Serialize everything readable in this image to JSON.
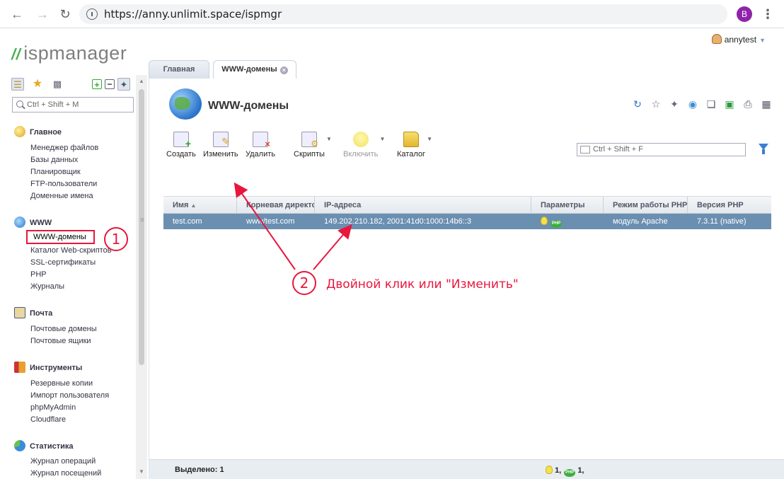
{
  "browser": {
    "url": "https://anny.unlimit.space/ispmgr",
    "profile_initial": "B"
  },
  "app": {
    "logo_text": "ispmanager",
    "user_name": "annytest"
  },
  "tabs": [
    {
      "label": "Главная"
    },
    {
      "label": "WWW-домены"
    }
  ],
  "sidebar": {
    "search_placeholder": "Ctrl + Shift + M",
    "sections": [
      {
        "title": "Главное",
        "items": [
          "Менеджер файлов",
          "Базы данных",
          "Планировщик",
          "FTP-пользователи",
          "Доменные имена"
        ]
      },
      {
        "title": "WWW",
        "items": [
          "WWW-домены",
          "Каталог Web-скриптов",
          "SSL-сертификаты",
          "PHP",
          "Журналы"
        ]
      },
      {
        "title": "Почта",
        "items": [
          "Почтовые домены",
          "Почтовые ящики"
        ]
      },
      {
        "title": "Инструменты",
        "items": [
          "Резервные копии",
          "Импорт пользователя",
          "phpMyAdmin",
          "Cloudflare"
        ]
      },
      {
        "title": "Статистика",
        "items": [
          "Журнал операций",
          "Журнал посещений"
        ]
      }
    ]
  },
  "main": {
    "title": "WWW-домены",
    "toolbar": {
      "create": "Создать",
      "edit": "Изменить",
      "delete": "Удалить",
      "scripts": "Скрипты",
      "enable": "Включить",
      "catalog": "Каталог"
    },
    "filter_placeholder": "Ctrl + Shift + F",
    "columns": [
      "Имя",
      "Корневая директория",
      "IP-адреса",
      "Параметры",
      "Режим работы PHP",
      "Версия PHP"
    ],
    "rows": [
      {
        "name": "test.com",
        "root": "www/test.com",
        "ip": "149.202.210.182, 2001:41d0:1000:14b6::3",
        "php_mode": "модуль Apache",
        "php_version": "7.3.11 (native)"
      }
    ],
    "status": {
      "selected": "Выделено: 1",
      "bulb_count": "1,",
      "php_count": "1,"
    }
  },
  "annotations": {
    "one": "1",
    "two": "2",
    "hint": "Двойной клик или \"Изменить\""
  },
  "colors": {
    "annotation": "#e8163d",
    "selected_row": "#6b8fb1"
  }
}
